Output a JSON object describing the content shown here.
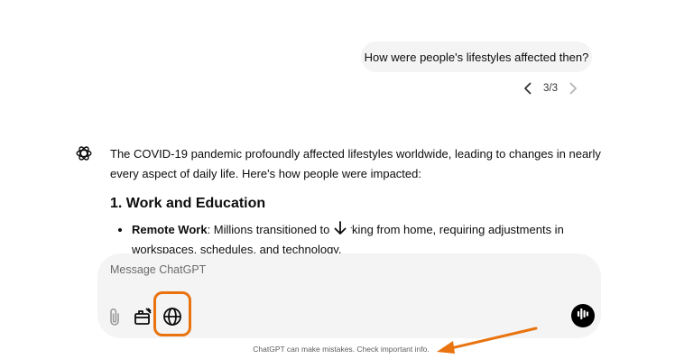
{
  "user_message": "How were people's lifestyles affected then?",
  "pager": {
    "label": "3/3",
    "prev_icon": "chevron-left-icon",
    "next_icon": "chevron-right-icon"
  },
  "assistant": {
    "avatar_icon": "openai-logo-icon",
    "intro": "The COVID-19 pandemic profoundly affected lifestyles worldwide, leading to changes in nearly every aspect of daily life. Here's how people were impacted:",
    "section_heading": "1. Work and Education",
    "bullets": [
      {
        "label": "Remote Work",
        "text": ": Millions transitioned to working from home, requiring adjustments in workspaces, schedules, and technology."
      }
    ]
  },
  "scroll_button_icon": "arrow-down-icon",
  "composer": {
    "placeholder": "Message ChatGPT",
    "attach_icon": "paperclip-icon",
    "tools_icon": "toolbox-icon",
    "search_icon": "globe-icon",
    "voice_icon": "voice-waveform-icon"
  },
  "disclaimer": "ChatGPT can make mistakes. Check important info.",
  "colors": {
    "highlight": "#e8730f",
    "composer_bg": "#f4f4f4",
    "bubble_bg": "#f4f4f4"
  }
}
